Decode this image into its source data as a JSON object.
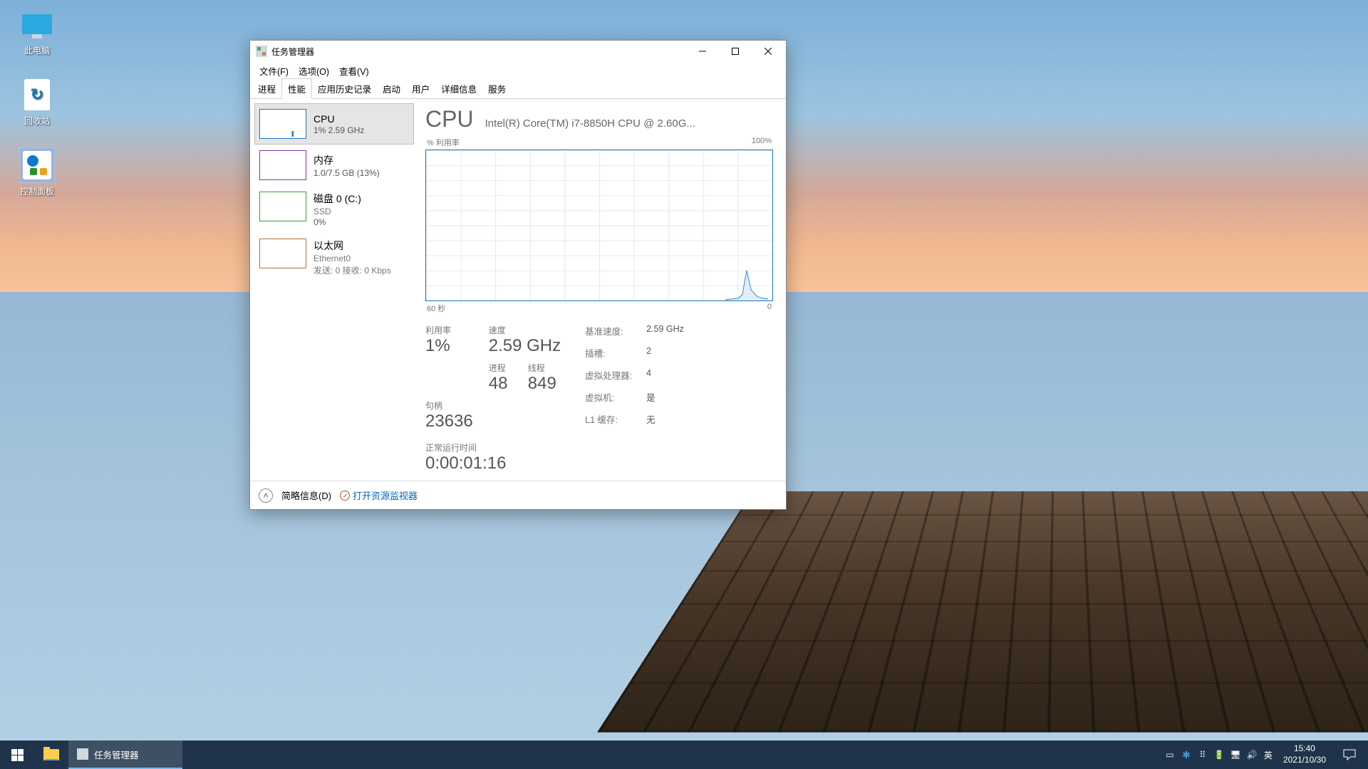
{
  "desktop": {
    "this_pc": "此电脑",
    "recycle_bin": "回收站",
    "control_panel": "控制面板"
  },
  "window": {
    "title": "任务管理器",
    "menu": {
      "file": "文件(F)",
      "options": "选项(O)",
      "view": "查看(V)"
    },
    "tabs": {
      "processes": "进程",
      "performance": "性能",
      "app_history": "应用历史记录",
      "startup": "启动",
      "users": "用户",
      "details": "详细信息",
      "services": "服务"
    },
    "side": {
      "cpu": {
        "title": "CPU",
        "sub": "1%  2.59 GHz"
      },
      "mem": {
        "title": "内存",
        "sub": "1.0/7.5 GB (13%)"
      },
      "disk": {
        "title": "磁盘 0 (C:)",
        "sub1": "SSD",
        "sub2": "0%"
      },
      "eth": {
        "title": "以太网",
        "sub1": "Ethernet0",
        "sub2": "发送: 0 接收: 0 Kbps"
      }
    },
    "main": {
      "heading": "CPU",
      "model": "Intel(R) Core(TM) i7-8850H CPU @ 2.60G...",
      "y_label": "% 利用率",
      "y_max": "100%",
      "x_left": "60 秒",
      "x_right": "0",
      "labels": {
        "util": "利用率",
        "speed": "速度",
        "procs": "进程",
        "threads": "线程",
        "handles": "句柄",
        "uptime": "正常运行时间",
        "base_speed": "基准速度:",
        "sockets": "插槽:",
        "logical": "虚拟处理器:",
        "virt": "虚拟机:",
        "l1": "L1 缓存:"
      },
      "values": {
        "util": "1%",
        "speed": "2.59 GHz",
        "procs": "48",
        "threads": "849",
        "handles": "23636",
        "uptime": "0:00:01:16",
        "base_speed": "2.59 GHz",
        "sockets": "2",
        "logical": "4",
        "virt": "是",
        "l1": "无"
      }
    },
    "footer": {
      "fewer": "简略信息(D)",
      "open_rm": "打开资源监视器"
    }
  },
  "taskbar": {
    "app": "任务管理器",
    "ime": "英",
    "time": "15:40",
    "date": "2021/10/30"
  },
  "chart_data": {
    "type": "line",
    "title": "CPU % 利用率",
    "xlabel": "秒",
    "ylabel": "% 利用率",
    "xlim": [
      60,
      0
    ],
    "ylim": [
      0,
      100
    ],
    "series": [
      {
        "name": "CPU",
        "x": [
          8,
          7,
          6,
          5,
          4,
          3,
          2,
          1,
          0
        ],
        "y": [
          0,
          1,
          2,
          8,
          25,
          10,
          4,
          2,
          1
        ]
      }
    ]
  }
}
